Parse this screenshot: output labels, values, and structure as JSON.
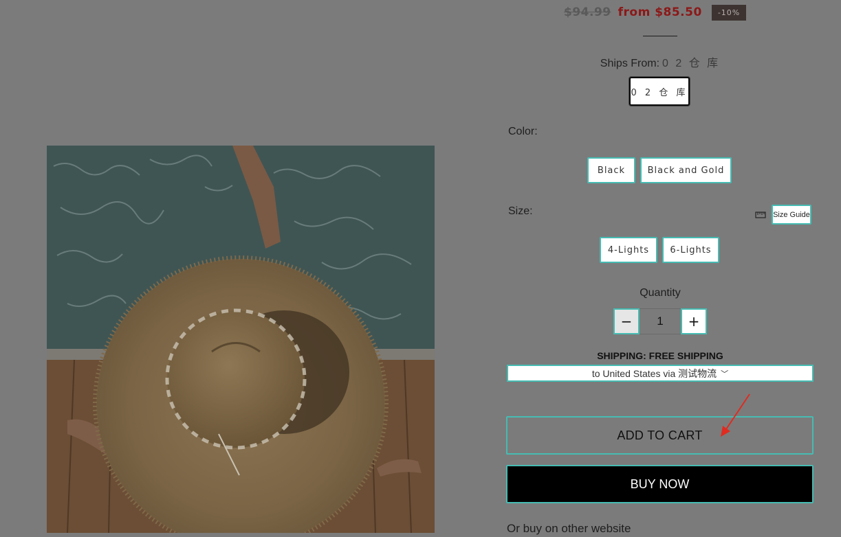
{
  "price": {
    "original": "$94.99",
    "sale": "from $85.50",
    "discount": "-10%"
  },
  "ships_from": {
    "label": "Ships From:",
    "selected": "0 2 仓 库",
    "options": [
      "0 2 仓 库"
    ]
  },
  "color": {
    "label": "Color:",
    "options": [
      "Black",
      "Black and Gold"
    ]
  },
  "size": {
    "label": "Size:",
    "size_guide_label": "Size Guide",
    "size_guide_icon": "ruler-icon",
    "options": [
      "4-Lights",
      "6-Lights"
    ]
  },
  "quantity": {
    "label": "Quantity",
    "value": "1",
    "minus_symbol": "−",
    "plus_symbol": "+"
  },
  "shipping": {
    "title": "SHIPPING: FREE SHIPPING",
    "destination": "to United States via 测试物流",
    "chevron": "﹀"
  },
  "actions": {
    "add_to_cart": "ADD TO CART",
    "buy_now": "BUY NOW",
    "other_website": "Or buy on other website"
  },
  "colors": {
    "accent_border": "#46bcb3",
    "sale_price": "#8c1818",
    "badge_bg": "#3d3331",
    "overlay_bg": "#7b7b7b",
    "annotation_arrow": "#e02b20"
  }
}
